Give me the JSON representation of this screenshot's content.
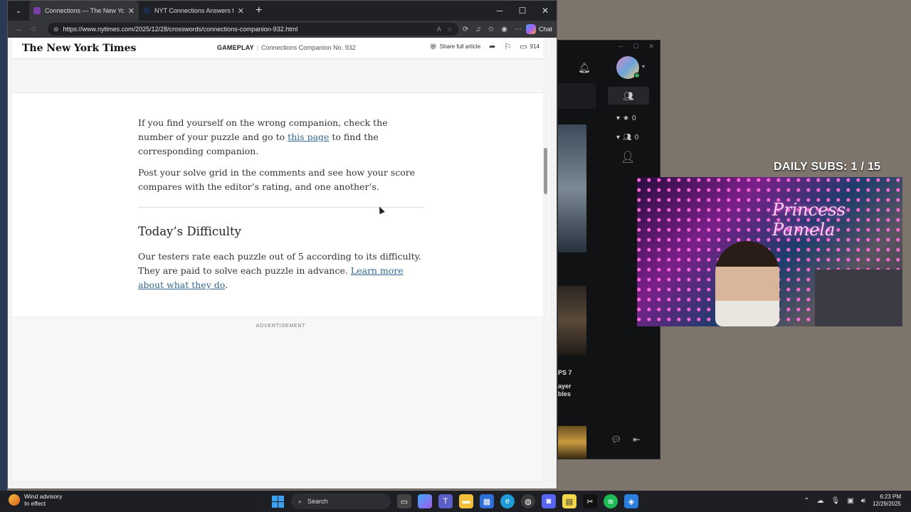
{
  "browser": {
    "tabs": [
      {
        "title": "Connections — The New York Times",
        "active": true,
        "favicon_color": "#7b3ea8"
      },
      {
        "title": "NYT Connections Answers for December",
        "active": false,
        "favicon_color": "#1c2c4c"
      }
    ],
    "url": "https://www.nytimes.com/2025/12/28/crosswords/connections-companion-932.html",
    "chat_label": "Chat"
  },
  "nyt": {
    "logo": "The New York Times",
    "section_kicker": "GAMEPLAY",
    "section_title": "Connections Companion No. 932",
    "share_label": "Share full article",
    "comment_count": "914"
  },
  "article": {
    "para1_before": "If you find yourself on the wrong companion, check the number of your puzzle and go to ",
    "para1_link": "this page",
    "para1_after": " to find the corresponding companion.",
    "para2": "Post your solve grid in the comments and see how your score compares with the editor’s rating, and one another’s.",
    "difficulty_heading": "Today’s Difficulty",
    "para3_before": "Our testers rate each puzzle out of 5 according to its difficulty. They are paid to solve each puzzle in advance. ",
    "para3_link": "Learn more about what they do",
    "para3_after": ".",
    "ad_label": "ADVERTISEMENT"
  },
  "darkapp": {
    "favorites_count": "0",
    "friends_count": "0",
    "thumb_text_line1": "PS 7",
    "thumb_text_line2": "ayer",
    "thumb_text_line3": "bles"
  },
  "overlay": {
    "daily_subs": "DAILY SUBS:  1 / 15",
    "cam_sign": "Princess Pamela"
  },
  "taskbar": {
    "weather_title": "Wind advisory",
    "weather_sub": "In effect",
    "search_label": "Search",
    "time": "6:23 PM",
    "date": "12/29/2025"
  }
}
